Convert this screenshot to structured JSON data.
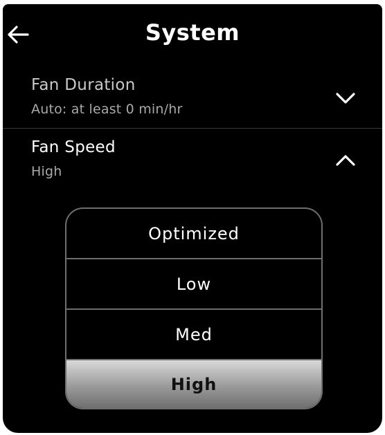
{
  "header": {
    "title": "System",
    "back_icon": "arrow-left-icon"
  },
  "fan_duration": {
    "label": "Fan Duration",
    "value": "Auto: at least 0 min/hr",
    "chevron_icon": "chevron-down-icon",
    "expanded": false
  },
  "fan_speed": {
    "label": "Fan Speed",
    "value": "High",
    "chevron_icon": "chevron-up-icon",
    "expanded": true,
    "options": [
      "Optimized",
      "Low",
      "Med",
      "High"
    ],
    "selected": "High"
  },
  "colors": {
    "background": "#000000",
    "text": "#ffffff",
    "subtext": "#a9a9a9",
    "option_border": "#6e6e6e",
    "selected_fill": "#b0b0b0"
  }
}
